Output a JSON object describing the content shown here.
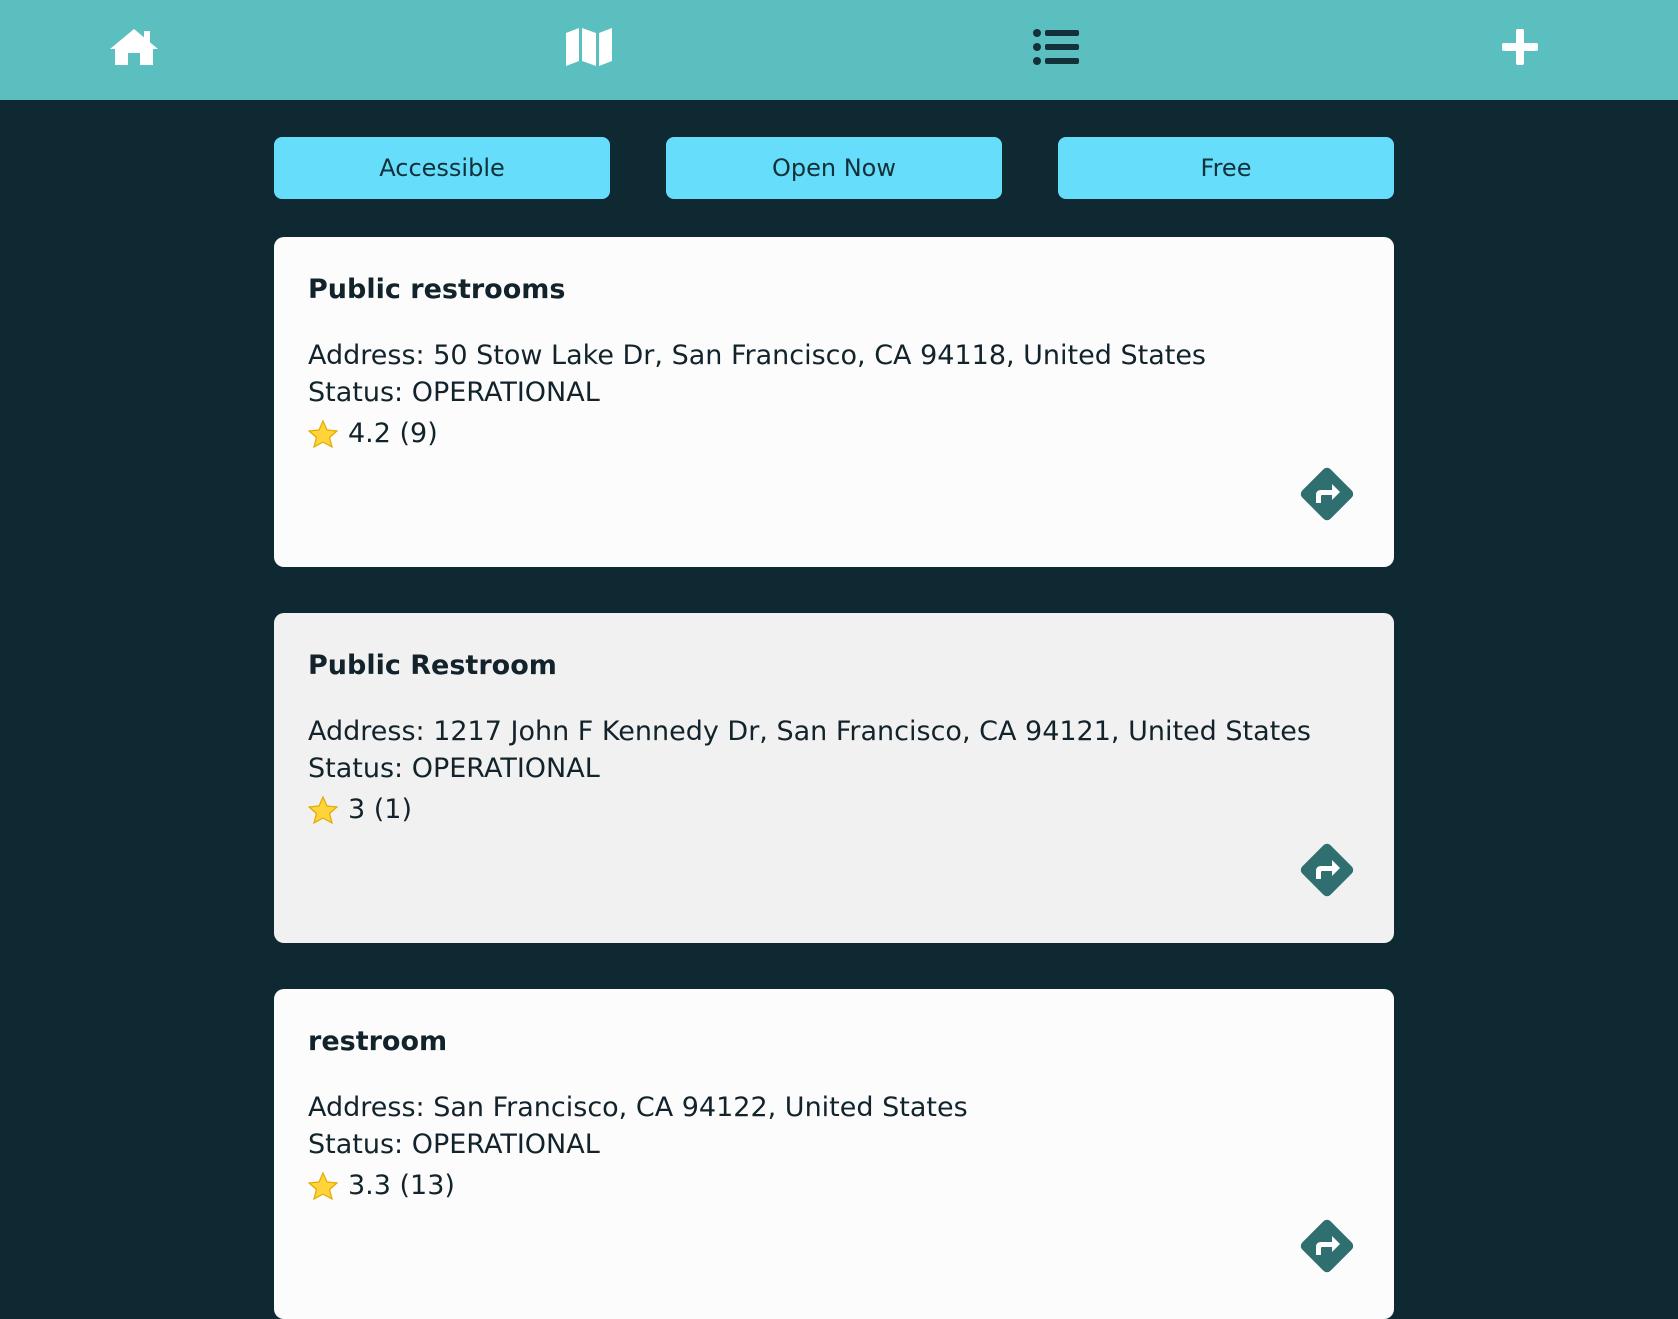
{
  "nav": {
    "items": [
      {
        "icon": "home-icon"
      },
      {
        "icon": "map-icon"
      },
      {
        "icon": "list-icon"
      },
      {
        "icon": "plus-icon"
      }
    ],
    "active_color": "#12313a",
    "inactive_color": "#ffffff"
  },
  "filters": {
    "accessible": "Accessible",
    "open_now": "Open Now",
    "free": "Free"
  },
  "restrooms": [
    {
      "name": "Public restrooms",
      "address": "Address: 50 Stow Lake Dr, San Francisco, CA 94118, United States",
      "status": "Status: OPERATIONAL",
      "rating": "4.2 (9)"
    },
    {
      "name": "Public Restroom",
      "address": "Address: 1217 John F Kennedy Dr, San Francisco, CA 94121, United States",
      "status": "Status: OPERATIONAL",
      "rating": "3 (1)"
    },
    {
      "name": "restroom",
      "address": "Address: San Francisco, CA 94122, United States",
      "status": "Status: OPERATIONAL",
      "rating": "3.3 (13)"
    }
  ],
  "colors": {
    "header": "#5bbfbf",
    "background": "#0f2933",
    "filter_button": "#66ddfa",
    "directions_icon": "#2f6f6f"
  }
}
